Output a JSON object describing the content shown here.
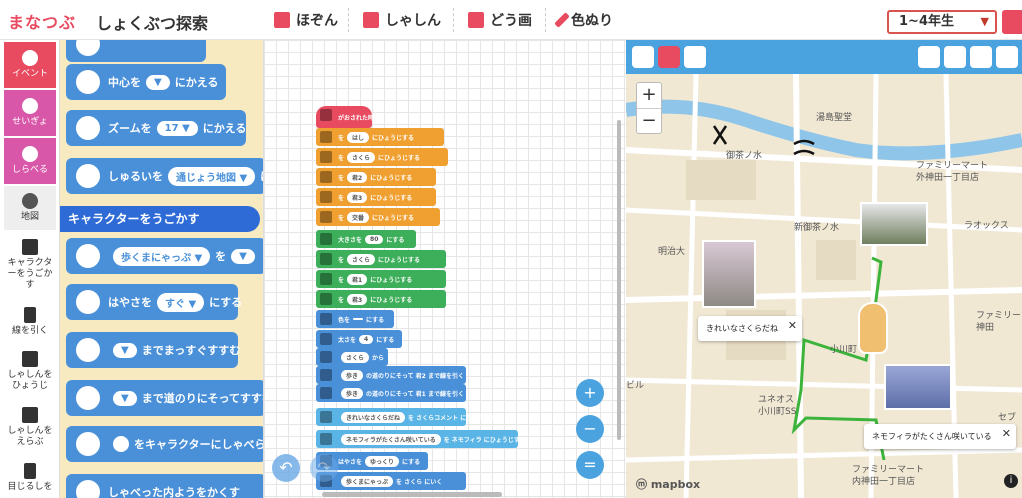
{
  "app": {
    "logo": "まなつぶ",
    "title": "しょくぶつ探索"
  },
  "toolbar": {
    "save": "ほぞん",
    "photo": "しゃしん",
    "video": "どう画",
    "paint": "色ぬり",
    "grade": "1~4年生"
  },
  "categories": [
    {
      "label": "イベント",
      "color": "#e84a5f"
    },
    {
      "label": "せいぎょ",
      "color": "#d957a8"
    },
    {
      "label": "しらべる",
      "color": "#d957a8"
    },
    {
      "label": "地図",
      "color": "#eeeeee"
    },
    {
      "label": "キャラクターをうごかす",
      "color": "#ffffff"
    },
    {
      "label": "線を引く",
      "color": "#ffffff"
    },
    {
      "label": "しゃしんをひょうじ",
      "color": "#ffffff"
    },
    {
      "label": "しゃしんをえらぶ",
      "color": "#ffffff"
    },
    {
      "label": "目じるしを",
      "color": "#ffffff"
    }
  ],
  "palette": {
    "center": {
      "a": "中心を",
      "b": "にかえる"
    },
    "zoom": {
      "a": "ズームを",
      "v": "17",
      "b": "にかえる"
    },
    "maptype": {
      "a": "しゅるいを",
      "v": "通じょう地図",
      "b": "に"
    },
    "header": "キャラクターをうごかす",
    "walk": {
      "v": "歩くまにゃっぷ",
      "b": "を"
    },
    "speed": {
      "a": "はやさを",
      "v": "すぐ",
      "b": "にする"
    },
    "straight": "までまっすぐすすむ",
    "road": "まで道のりにそってすすむ",
    "speak": "をキャラクターにしゃべらせ",
    "hide": "しゃべった内ようをかくす"
  },
  "workspace": {
    "hat": "がおされた時",
    "blocks": [
      {
        "text": "を",
        "d1": "はし",
        "d2": "にひょうじする",
        "color": "#f0a030"
      },
      {
        "text": "を",
        "d1": "さくら",
        "d2": "にひょうじする",
        "color": "#f0a030"
      },
      {
        "text": "を",
        "d1": "君2",
        "d2": "にひょうじする",
        "color": "#f0a030"
      },
      {
        "text": "を",
        "d1": "君3",
        "d2": "にひょうじする",
        "color": "#f0a030"
      },
      {
        "text": "を",
        "d1": "交番",
        "d2": "にひょうじする",
        "color": "#f0a030"
      },
      {
        "text": "大きさを",
        "d1": "80",
        "d2": "にする",
        "color": "#3dae5a"
      },
      {
        "text": "を",
        "d1": "さくら",
        "d2": "にひょうじする",
        "color": "#3dae5a"
      },
      {
        "text": "を",
        "d1": "君1",
        "d2": "にひょうじする",
        "color": "#3dae5a"
      },
      {
        "text": "を",
        "d1": "君3",
        "d2": "にひょうじする",
        "color": "#3dae5a"
      },
      {
        "text": "色を",
        "d1": "",
        "d2": "にする",
        "color": "#4a90d9"
      },
      {
        "text": "太さを",
        "d1": "4",
        "d2": "にする",
        "color": "#4a90d9"
      },
      {
        "text": "",
        "d1": "さくら",
        "d2": "から",
        "color": "#4a90d9"
      },
      {
        "text": "",
        "d1": "歩き",
        "d2": "の道のりにそって 君2 まで線を引く",
        "color": "#4a90d9"
      },
      {
        "text": "",
        "d1": "歩き",
        "d2": "の道のりにそって 君1 まで線を引く",
        "color": "#4a90d9"
      },
      {
        "text": "",
        "d1": "きれいなさくらだね",
        "d2": "を さくらコメント にひょうじする",
        "color": "#5ab4e6"
      },
      {
        "text": "",
        "d1": "ネモフィラがたくさん咲いている",
        "d2": "を ネモフィラ にひょうじする",
        "color": "#5ab4e6"
      },
      {
        "text": "はやさを",
        "d1": "ゆっくり",
        "d2": "にする",
        "color": "#4a90d9"
      },
      {
        "text": "",
        "d1": "歩くまにゃっぷ",
        "d2": "を さくら にいく",
        "color": "#4a90d9"
      }
    ]
  },
  "map": {
    "labels": [
      "湯島聖堂",
      "御茶ノ水",
      "新御茶ノ水",
      "明治大",
      "ファミリーマート",
      "外神田一丁目店",
      "ラオックス",
      "ファミリー",
      "神田",
      "小川町",
      "ユネオス",
      "小川町SS",
      "ファミリーマート",
      "内神田一丁目店",
      "セブ",
      "ビル"
    ],
    "popup1": "きれいなさくらだね",
    "popup2": "ネモフィラがたくさん咲いている",
    "attribution": "mapbox",
    "route_color": "#3cb43c"
  }
}
